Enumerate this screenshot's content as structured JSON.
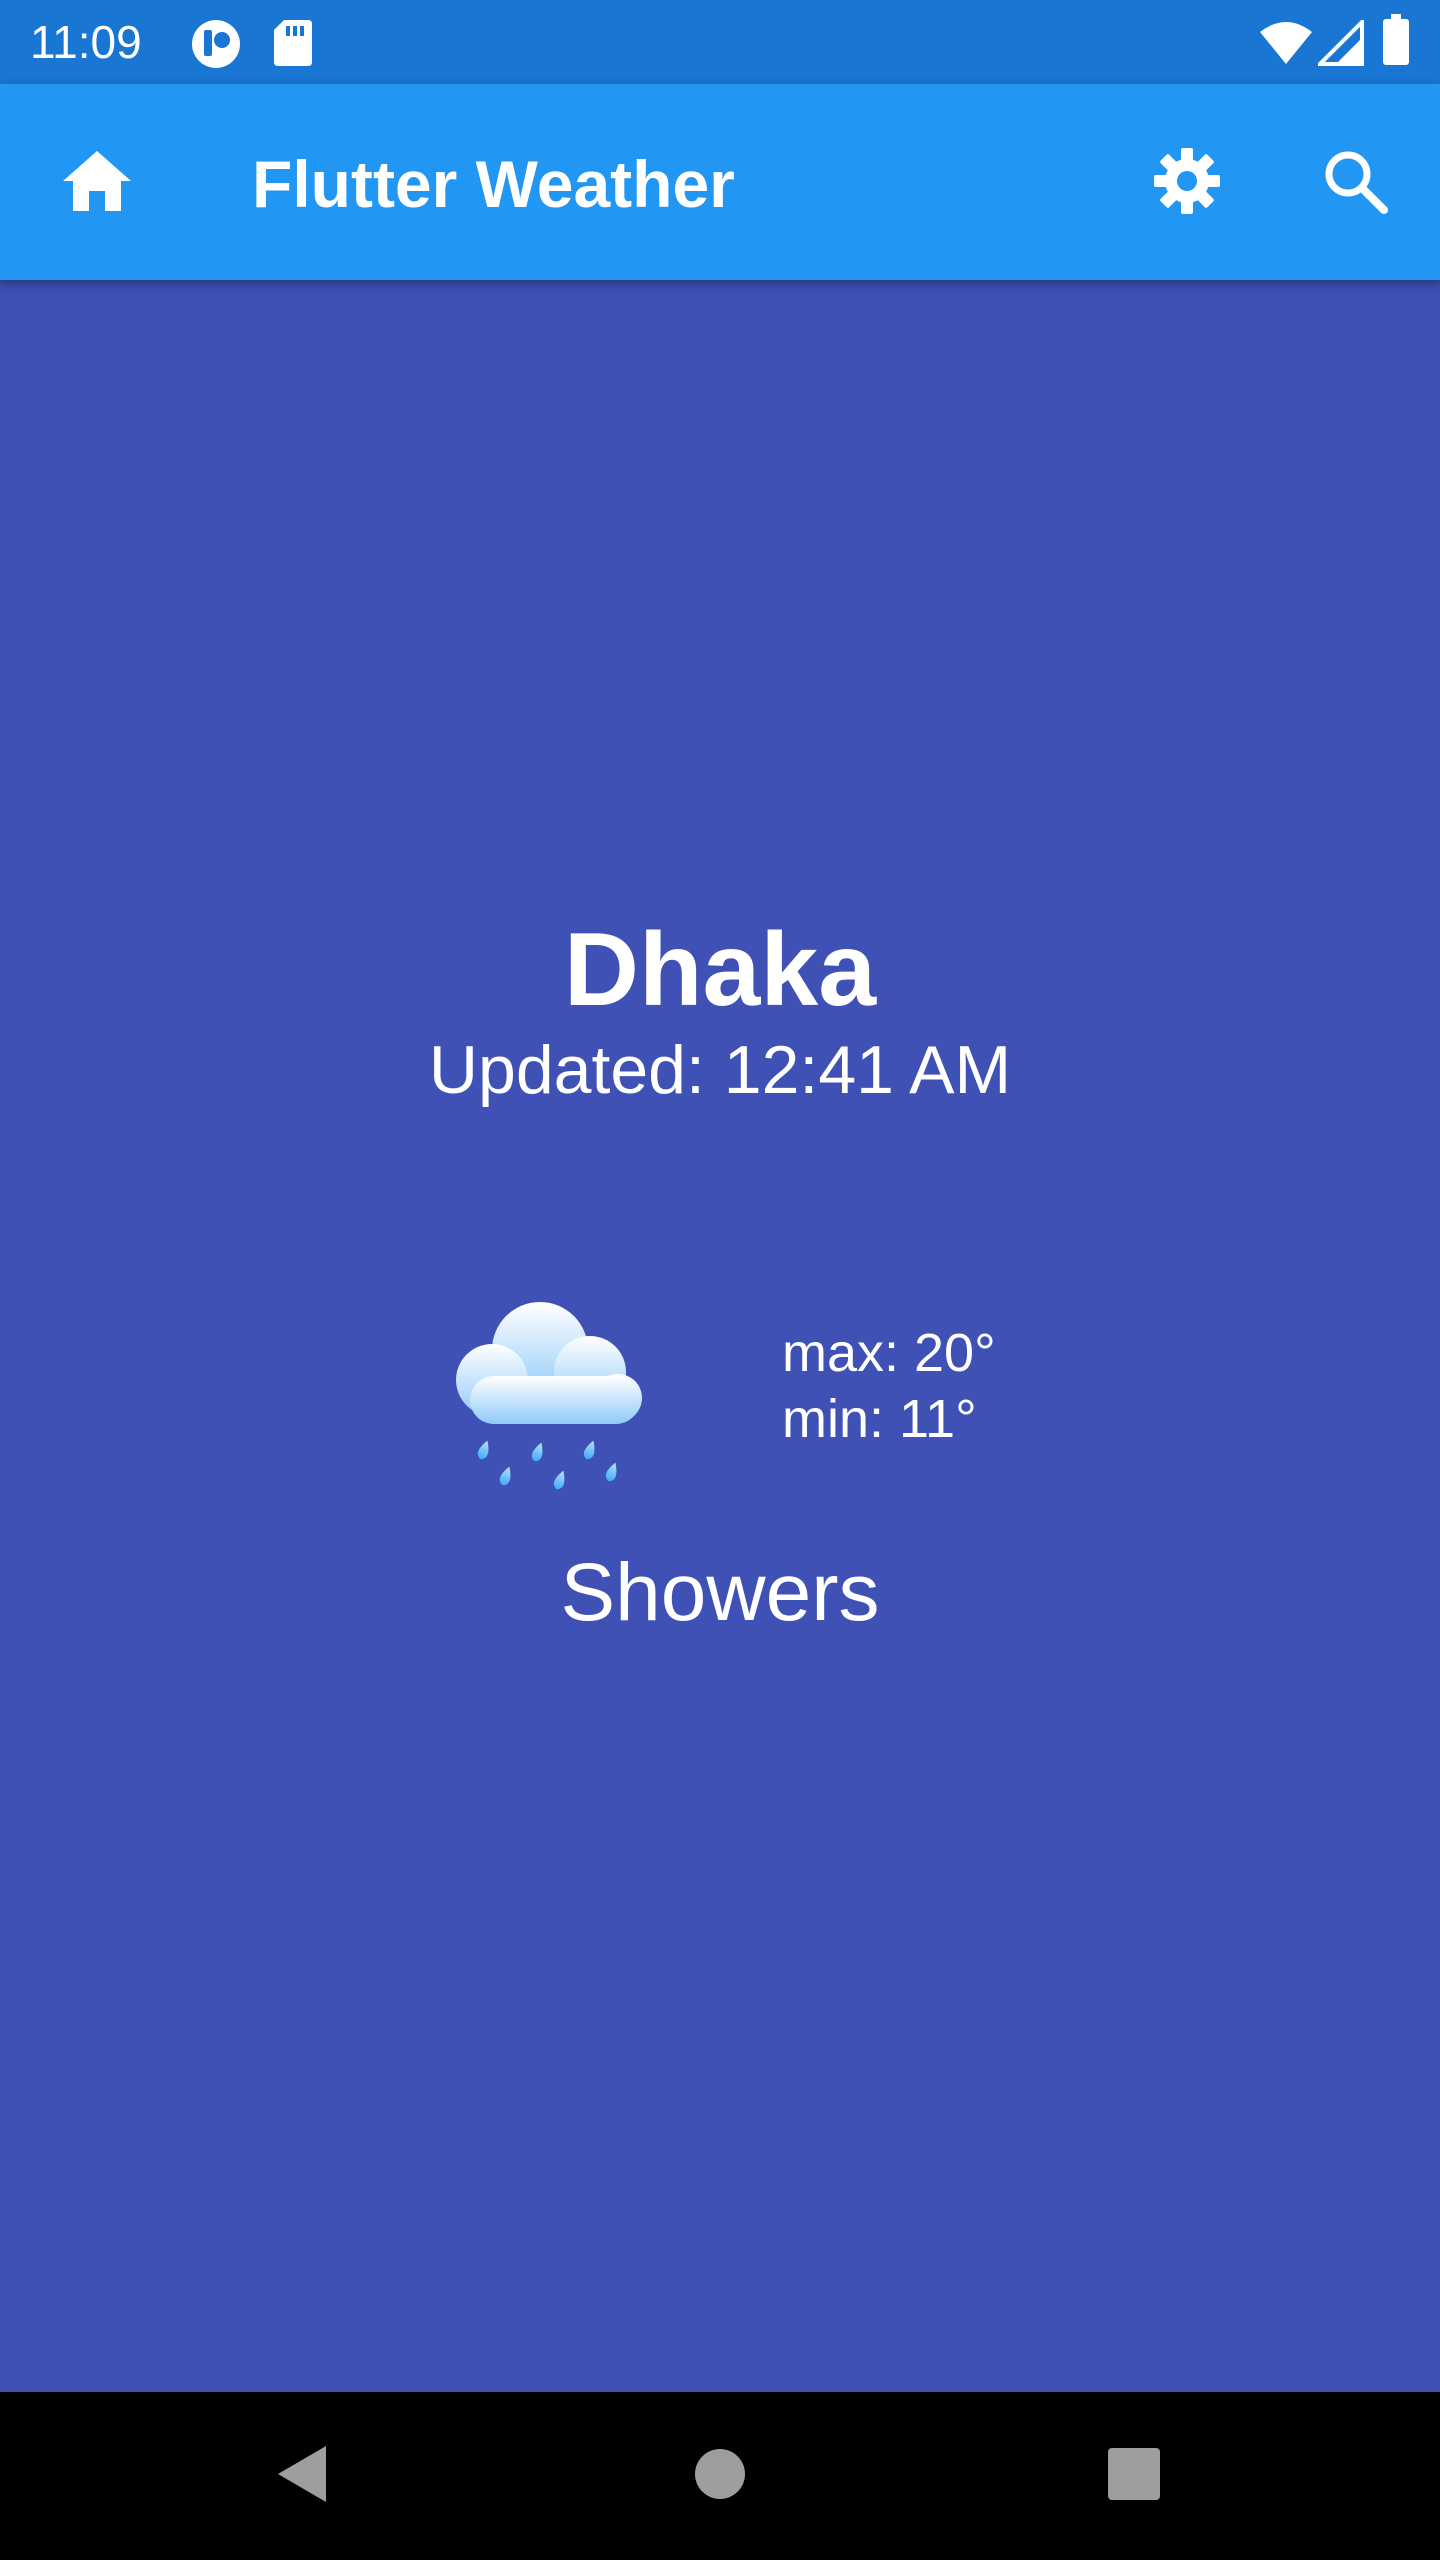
{
  "status_bar": {
    "time": "11:09",
    "icons": [
      "notification-app-icon",
      "sd-card-icon",
      "wifi-icon",
      "cell-signal-icon",
      "battery-icon"
    ]
  },
  "app_bar": {
    "title": "Flutter Weather",
    "icons": [
      "home-icon",
      "settings-icon",
      "search-icon"
    ]
  },
  "weather": {
    "city": "Dhaka",
    "updated": "Updated: 12:41 AM",
    "max": "max: 20°",
    "min": "min: 11°",
    "condition": "Showers",
    "icon": "rain-cloud-icon"
  },
  "nav_bar": {
    "icons": [
      "back-icon",
      "home-circle-icon",
      "recents-icon"
    ]
  },
  "colors": {
    "status_bar": "#1976D2",
    "app_bar": "#2196F3",
    "background": "#3F51B5",
    "nav_bar": "#000000",
    "text": "#FFFFFF"
  }
}
